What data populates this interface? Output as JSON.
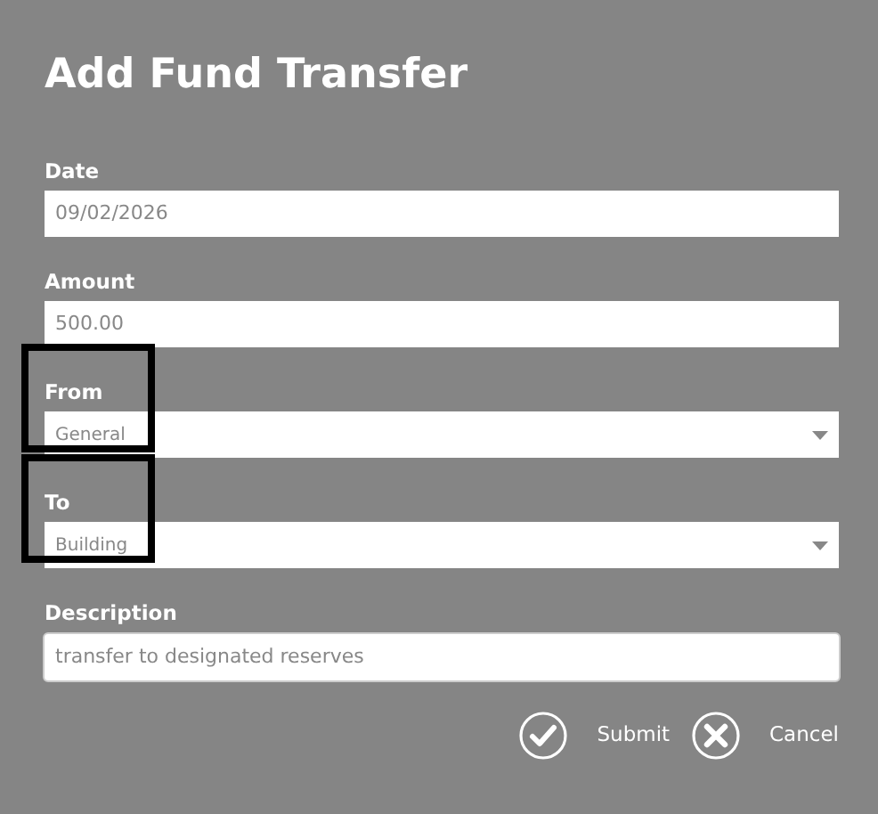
{
  "title": "Add Fund Transfer",
  "fields": [
    {
      "kind": "text",
      "label": "Date",
      "value": "09/02/2026",
      "highlighted": false
    },
    {
      "kind": "text",
      "label": "Amount",
      "value": "500.00",
      "highlighted": false
    },
    {
      "kind": "select",
      "label": "From",
      "value": "General",
      "highlighted": true
    },
    {
      "kind": "select",
      "label": "To",
      "value": "Building",
      "highlighted": true
    },
    {
      "kind": "bordered",
      "label": "Description",
      "value": "transfer to designated reserves",
      "highlighted": false
    }
  ],
  "buttons": [
    {
      "kind": "submit",
      "label": "Submit"
    },
    {
      "kind": "cancel",
      "label": "Cancel"
    }
  ]
}
